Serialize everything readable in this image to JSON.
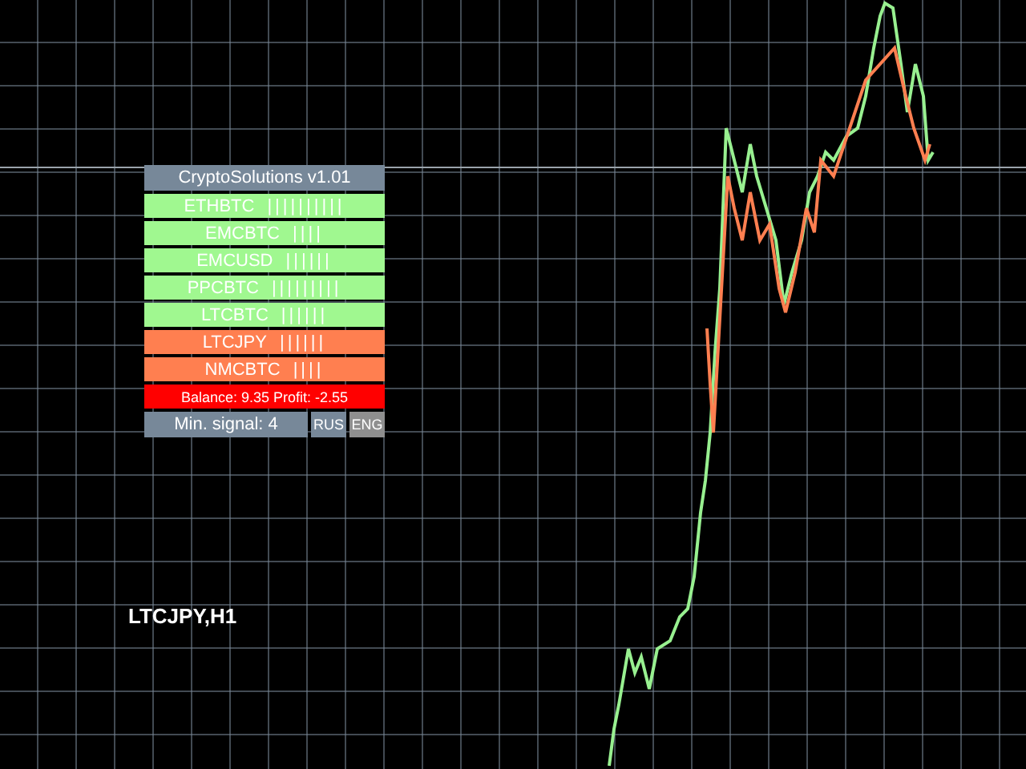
{
  "panel": {
    "title": "CryptoSolutions v1.01",
    "rows": [
      {
        "symbol": "ETHBTC",
        "bars": "||||||||||",
        "color": "#a0f890"
      },
      {
        "symbol": "EMCBTC",
        "bars": "||||",
        "color": "#a0f890"
      },
      {
        "symbol": "EMCUSD",
        "bars": "||||||",
        "color": "#a0f890"
      },
      {
        "symbol": "PPCBTC",
        "bars": "|||||||||",
        "color": "#a0f890"
      },
      {
        "symbol": "LTCBTC",
        "bars": "||||||",
        "color": "#a0f890"
      },
      {
        "symbol": "LTCJPY",
        "bars": "||||||",
        "color": "#ff7f50"
      },
      {
        "symbol": "NMCBTC",
        "bars": "||||",
        "color": "#ff7f50"
      }
    ],
    "balance": "Balance: 9.35 Profit: -2.55",
    "min_signal": "Min. signal: 4",
    "languages": [
      {
        "label": "RUS",
        "selected": true
      },
      {
        "label": "ENG",
        "selected": false
      }
    ]
  },
  "chart": {
    "symbol_label": "LTCJPY,H1"
  }
}
